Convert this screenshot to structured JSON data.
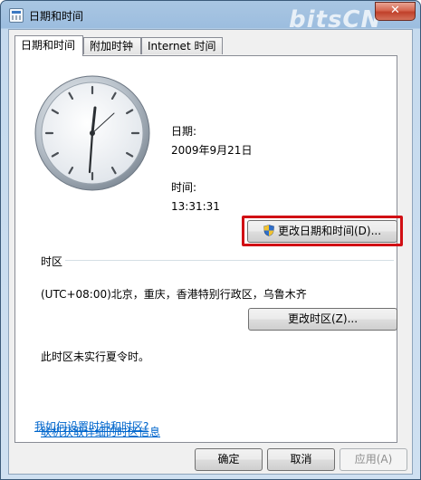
{
  "window": {
    "title": "日期和时间",
    "watermark": "bitsCN",
    "close_glyph": "✕"
  },
  "tabs": [
    {
      "label": "日期和时间",
      "active": true
    },
    {
      "label": "附加时钟",
      "active": false
    },
    {
      "label": "Internet 时间",
      "active": false
    }
  ],
  "datetime": {
    "date_label": "日期:",
    "date_value": "2009年9月21日",
    "time_label": "时间:",
    "time_value": "13:31:31",
    "change_button": "更改日期和时间(D)..."
  },
  "timezone": {
    "section_label": "时区",
    "current": "(UTC+08:00)北京，重庆，香港特别行政区，乌鲁木齐",
    "change_button": "更改时区(Z)...",
    "dst_note": "此时区未实行夏令时。"
  },
  "links": {
    "online_info": "联机获取详细的时区信息",
    "how_to": "我如何设置时钟和时区?"
  },
  "footer": {
    "ok": "确定",
    "cancel": "取消",
    "apply": "应用(A)"
  },
  "colors": {
    "highlight": "#d10f14",
    "link": "#0066cc"
  },
  "icons": {
    "shield": "uac-shield-icon",
    "app": "calendar-clock-icon",
    "close": "close-icon"
  }
}
